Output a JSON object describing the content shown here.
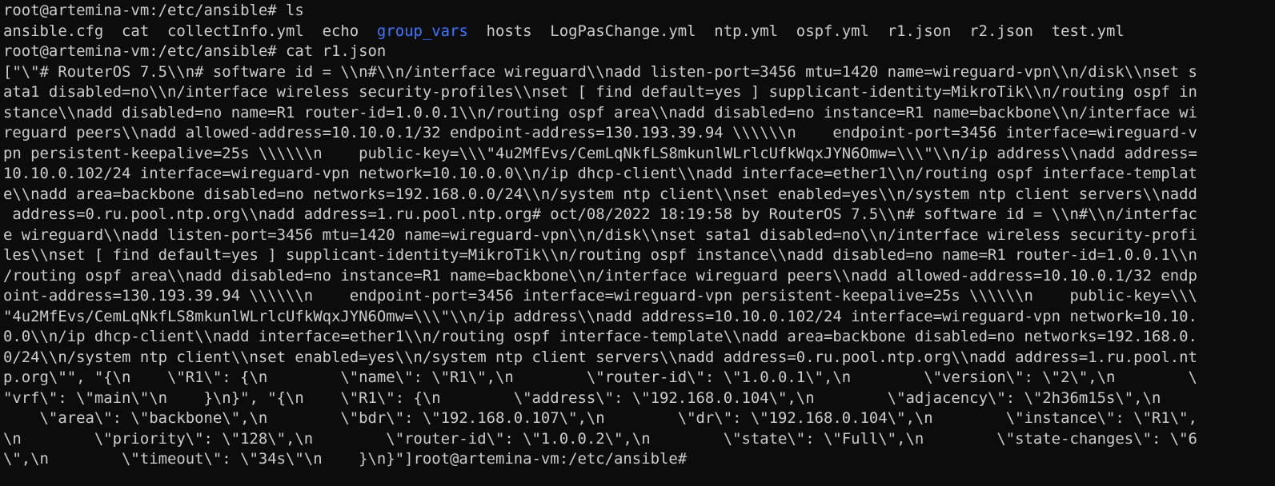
{
  "terminal": {
    "prompt_1": "root@artemina-vm:/etc/ansible# ls",
    "ls_output": {
      "before_dir": "ansible.cfg  cat  collectInfo.yml  echo  ",
      "dir": "group_vars",
      "after_dir": "  hosts  LogPasChange.yml  ntp.yml  ospf.yml  r1.json  r2.json  test.yml"
    },
    "prompt_2": "root@artemina-vm:/etc/ansible# cat r1.json",
    "output_lines": [
      "[\"\\\"# RouterOS 7.5\\\\n# software id = \\\\n#\\\\n/interface wireguard\\\\nadd listen-port=3456 mtu=1420 name=wireguard-vpn\\\\n/disk\\\\nset s",
      "ata1 disabled=no\\\\n/interface wireless security-profiles\\\\nset [ find default=yes ] supplicant-identity=MikroTik\\\\n/routing ospf in",
      "stance\\\\nadd disabled=no name=R1 router-id=1.0.0.1\\\\n/routing ospf area\\\\nadd disabled=no instance=R1 name=backbone\\\\n/interface wi",
      "reguard peers\\\\nadd allowed-address=10.10.0.1/32 endpoint-address=130.193.39.94 \\\\\\\\\\\\n    endpoint-port=3456 interface=wireguard-v",
      "pn persistent-keepalive=25s \\\\\\\\\\\\n    public-key=\\\\\\\"4u2MfEvs/CemLqNkfLS8mkunlWLrlcUfkWqxJYN6Omw=\\\\\\\"\\\\n/ip address\\\\nadd address=",
      "10.10.0.102/24 interface=wireguard-vpn network=10.10.0.0\\\\n/ip dhcp-client\\\\nadd interface=ether1\\\\n/routing ospf interface-templat",
      "e\\\\nadd area=backbone disabled=no networks=192.168.0.0/24\\\\n/system ntp client\\\\nset enabled=yes\\\\n/system ntp client servers\\\\nadd",
      " address=0.ru.pool.ntp.org\\\\nadd address=1.ru.pool.ntp.org# oct/08/2022 18:19:58 by RouterOS 7.5\\\\n# software id = \\\\n#\\\\n/interfac",
      "e wireguard\\\\nadd listen-port=3456 mtu=1420 name=wireguard-vpn\\\\n/disk\\\\nset sata1 disabled=no\\\\n/interface wireless security-profi",
      "les\\\\nset [ find default=yes ] supplicant-identity=MikroTik\\\\n/routing ospf instance\\\\nadd disabled=no name=R1 router-id=1.0.0.1\\\\n",
      "/routing ospf area\\\\nadd disabled=no instance=R1 name=backbone\\\\n/interface wireguard peers\\\\nadd allowed-address=10.10.0.1/32 endp",
      "oint-address=130.193.39.94 \\\\\\\\\\\\n    endpoint-port=3456 interface=wireguard-vpn persistent-keepalive=25s \\\\\\\\\\\\n    public-key=\\\\\\",
      "\"4u2MfEvs/CemLqNkfLS8mkunlWLrlcUfkWqxJYN6Omw=\\\\\\\"\\\\n/ip address\\\\nadd address=10.10.0.102/24 interface=wireguard-vpn network=10.10.",
      "0.0\\\\n/ip dhcp-client\\\\nadd interface=ether1\\\\n/routing ospf interface-template\\\\nadd area=backbone disabled=no networks=192.168.0.",
      "0/24\\\\n/system ntp client\\\\nset enabled=yes\\\\n/system ntp client servers\\\\nadd address=0.ru.pool.ntp.org\\\\nadd address=1.ru.pool.nt",
      "p.org\\\"\", \"{\\n    \\\"R1\\\": {\\n        \\\"name\\\": \\\"R1\\\",\\n        \\\"router-id\\\": \\\"1.0.0.1\\\",\\n        \\\"version\\\": \\\"2\\\",\\n        \\",
      "\"vrf\\\": \\\"main\\\"\\n    }\\n}\", \"{\\n    \\\"R1\\\": {\\n        \\\"address\\\": \\\"192.168.0.104\\\",\\n        \\\"adjacency\\\": \\\"2h36m15s\\\",\\n",
      "    \\\"area\\\": \\\"backbone\\\",\\n        \\\"bdr\\\": \\\"192.168.0.107\\\",\\n        \\\"dr\\\": \\\"192.168.0.104\\\",\\n        \\\"instance\\\": \\\"R1\\\",",
      "\\n        \\\"priority\\\": \\\"128\\\",\\n        \\\"router-id\\\": \\\"1.0.0.2\\\",\\n        \\\"state\\\": \\\"Full\\\",\\n        \\\"state-changes\\\": \\\"6",
      "\\\",\\n        \\\"timeout\\\": \\\"34s\\\"\\n    }\\n}\"]root@artemina-vm:/etc/ansible# "
    ],
    "colors": {
      "background": "#0c0c0c",
      "foreground": "#cccccc",
      "directory": "#3b78ff"
    }
  }
}
